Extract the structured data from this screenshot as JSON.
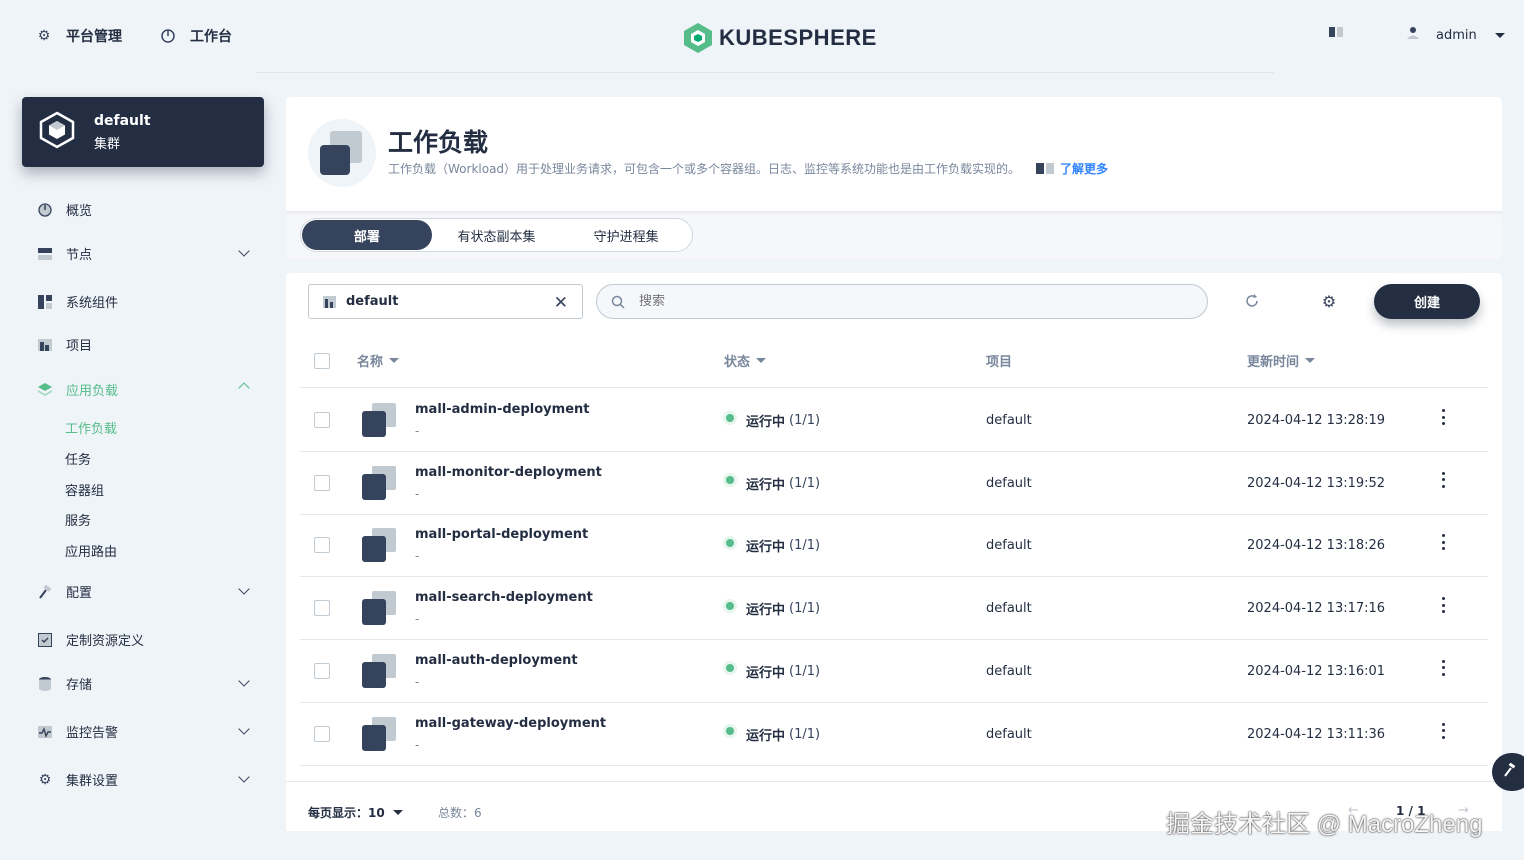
{
  "topbar": {
    "platform_label": "平台管理",
    "workbench_label": "工作台",
    "logo_text": "KUBESPHERE",
    "username": "admin"
  },
  "cluster": {
    "name": "default",
    "type": "集群"
  },
  "sidebar": {
    "items": [
      {
        "label": "概览",
        "icon": "dashboard-icon"
      },
      {
        "label": "节点",
        "icon": "nodes-icon"
      },
      {
        "label": "系统组件",
        "icon": "components-icon"
      },
      {
        "label": "项目",
        "icon": "project-icon"
      },
      {
        "label": "应用负载",
        "icon": "workload-layers-icon"
      },
      {
        "label": "配置",
        "icon": "hammer-icon"
      },
      {
        "label": "定制资源定义",
        "icon": "crd-icon"
      },
      {
        "label": "存储",
        "icon": "storage-icon"
      },
      {
        "label": "监控告警",
        "icon": "monitor-icon"
      },
      {
        "label": "集群设置",
        "icon": "gear-icon"
      }
    ],
    "sub_items": [
      "工作负载",
      "任务",
      "容器组",
      "服务",
      "应用路由"
    ]
  },
  "header": {
    "title": "工作负载",
    "description": "工作负载（Workload）用于处理业务请求，可包含一个或多个容器组。日志、监控等系统功能也是由工作负载实现的。",
    "learn_more": "了解更多"
  },
  "tabs": [
    "部署",
    "有状态副本集",
    "守护进程集"
  ],
  "toolbar": {
    "namespace": "default",
    "search_placeholder": "搜索",
    "create_label": "创建"
  },
  "table": {
    "headers": [
      "名称",
      "状态",
      "项目",
      "更新时间"
    ],
    "rows": [
      {
        "name": "mall-admin-deployment",
        "desc": "-",
        "status": "运行中",
        "count": "(1/1)",
        "project": "default",
        "updated": "2024-04-12 13:28:19"
      },
      {
        "name": "mall-monitor-deployment",
        "desc": "-",
        "status": "运行中",
        "count": "(1/1)",
        "project": "default",
        "updated": "2024-04-12 13:19:52"
      },
      {
        "name": "mall-portal-deployment",
        "desc": "-",
        "status": "运行中",
        "count": "(1/1)",
        "project": "default",
        "updated": "2024-04-12 13:18:26"
      },
      {
        "name": "mall-search-deployment",
        "desc": "-",
        "status": "运行中",
        "count": "(1/1)",
        "project": "default",
        "updated": "2024-04-12 13:17:16"
      },
      {
        "name": "mall-auth-deployment",
        "desc": "-",
        "status": "运行中",
        "count": "(1/1)",
        "project": "default",
        "updated": "2024-04-12 13:16:01"
      },
      {
        "name": "mall-gateway-deployment",
        "desc": "-",
        "status": "运行中",
        "count": "(1/1)",
        "project": "default",
        "updated": "2024-04-12 13:11:36"
      }
    ]
  },
  "pagination": {
    "per_page_label": "每页显示：",
    "per_page": "10",
    "total_label": "总数：",
    "total": "6",
    "page": "1 / 1"
  },
  "colors": {
    "accent": "#55bc8a",
    "dark": "#242e42",
    "link": "#3385ff"
  },
  "watermark": "掘金技术社区 @ MacroZheng"
}
